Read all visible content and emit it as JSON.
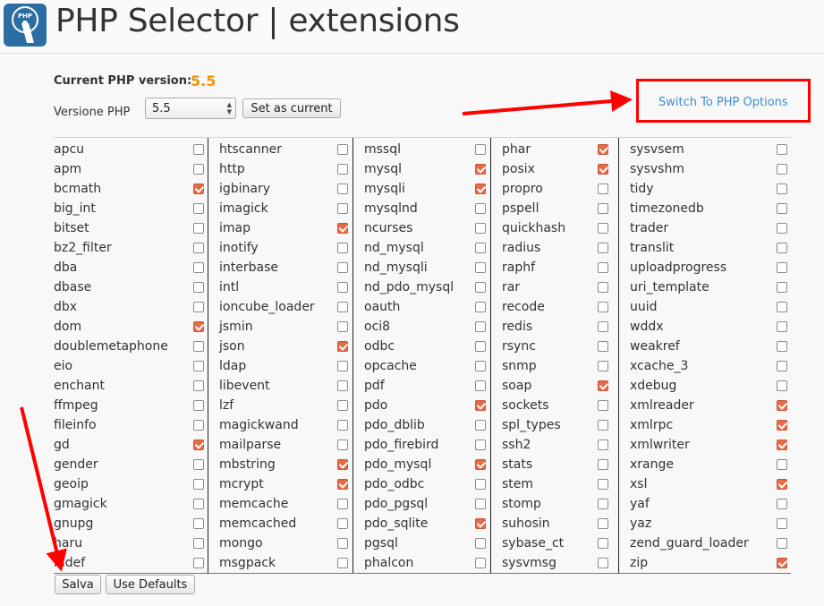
{
  "header": {
    "title": "PHP Selector | extensions",
    "logo_icon": "php-selector-logo-icon",
    "logo_text": "PHP"
  },
  "current": {
    "label": "Current PHP version:",
    "value": "5.5"
  },
  "version": {
    "label": "Versione PHP",
    "selected": "5.5",
    "set_button": "Set as current"
  },
  "switch_link": "Switch To PHP Options",
  "columns": [
    [
      {
        "name": "apcu",
        "on": false
      },
      {
        "name": "apm",
        "on": false
      },
      {
        "name": "bcmath",
        "on": true
      },
      {
        "name": "big_int",
        "on": false
      },
      {
        "name": "bitset",
        "on": false
      },
      {
        "name": "bz2_filter",
        "on": false
      },
      {
        "name": "dba",
        "on": false
      },
      {
        "name": "dbase",
        "on": false
      },
      {
        "name": "dbx",
        "on": false
      },
      {
        "name": "dom",
        "on": true
      },
      {
        "name": "doublemetaphone",
        "on": false
      },
      {
        "name": "eio",
        "on": false
      },
      {
        "name": "enchant",
        "on": false
      },
      {
        "name": "ffmpeg",
        "on": false
      },
      {
        "name": "fileinfo",
        "on": false
      },
      {
        "name": "gd",
        "on": true
      },
      {
        "name": "gender",
        "on": false
      },
      {
        "name": "geoip",
        "on": false
      },
      {
        "name": "gmagick",
        "on": false
      },
      {
        "name": "gnupg",
        "on": false
      },
      {
        "name": "haru",
        "on": false
      },
      {
        "name": "hidef",
        "on": false
      }
    ],
    [
      {
        "name": "htscanner",
        "on": false
      },
      {
        "name": "http",
        "on": false
      },
      {
        "name": "igbinary",
        "on": false
      },
      {
        "name": "imagick",
        "on": false
      },
      {
        "name": "imap",
        "on": true
      },
      {
        "name": "inotify",
        "on": false
      },
      {
        "name": "interbase",
        "on": false
      },
      {
        "name": "intl",
        "on": false
      },
      {
        "name": "ioncube_loader",
        "on": false
      },
      {
        "name": "jsmin",
        "on": false
      },
      {
        "name": "json",
        "on": true
      },
      {
        "name": "ldap",
        "on": false
      },
      {
        "name": "libevent",
        "on": false
      },
      {
        "name": "lzf",
        "on": false
      },
      {
        "name": "magickwand",
        "on": false
      },
      {
        "name": "mailparse",
        "on": false
      },
      {
        "name": "mbstring",
        "on": true
      },
      {
        "name": "mcrypt",
        "on": true
      },
      {
        "name": "memcache",
        "on": false
      },
      {
        "name": "memcached",
        "on": false
      },
      {
        "name": "mongo",
        "on": false
      },
      {
        "name": "msgpack",
        "on": false
      }
    ],
    [
      {
        "name": "mssql",
        "on": false
      },
      {
        "name": "mysql",
        "on": true
      },
      {
        "name": "mysqli",
        "on": true
      },
      {
        "name": "mysqlnd",
        "on": false
      },
      {
        "name": "ncurses",
        "on": false
      },
      {
        "name": "nd_mysql",
        "on": false
      },
      {
        "name": "nd_mysqli",
        "on": false
      },
      {
        "name": "nd_pdo_mysql",
        "on": false
      },
      {
        "name": "oauth",
        "on": false
      },
      {
        "name": "oci8",
        "on": false
      },
      {
        "name": "odbc",
        "on": false
      },
      {
        "name": "opcache",
        "on": false
      },
      {
        "name": "pdf",
        "on": false
      },
      {
        "name": "pdo",
        "on": true
      },
      {
        "name": "pdo_dblib",
        "on": false
      },
      {
        "name": "pdo_firebird",
        "on": false
      },
      {
        "name": "pdo_mysql",
        "on": true
      },
      {
        "name": "pdo_odbc",
        "on": false
      },
      {
        "name": "pdo_pgsql",
        "on": false
      },
      {
        "name": "pdo_sqlite",
        "on": true
      },
      {
        "name": "pgsql",
        "on": false
      },
      {
        "name": "phalcon",
        "on": false
      }
    ],
    [
      {
        "name": "phar",
        "on": true
      },
      {
        "name": "posix",
        "on": true
      },
      {
        "name": "propro",
        "on": false
      },
      {
        "name": "pspell",
        "on": false
      },
      {
        "name": "quickhash",
        "on": false
      },
      {
        "name": "radius",
        "on": false
      },
      {
        "name": "raphf",
        "on": false
      },
      {
        "name": "rar",
        "on": false
      },
      {
        "name": "recode",
        "on": false
      },
      {
        "name": "redis",
        "on": false
      },
      {
        "name": "rsync",
        "on": false
      },
      {
        "name": "snmp",
        "on": false
      },
      {
        "name": "soap",
        "on": true
      },
      {
        "name": "sockets",
        "on": false
      },
      {
        "name": "spl_types",
        "on": false
      },
      {
        "name": "ssh2",
        "on": false
      },
      {
        "name": "stats",
        "on": false
      },
      {
        "name": "stem",
        "on": false
      },
      {
        "name": "stomp",
        "on": false
      },
      {
        "name": "suhosin",
        "on": false
      },
      {
        "name": "sybase_ct",
        "on": false
      },
      {
        "name": "sysvmsg",
        "on": false
      }
    ],
    [
      {
        "name": "sysvsem",
        "on": false
      },
      {
        "name": "sysvshm",
        "on": false
      },
      {
        "name": "tidy",
        "on": false
      },
      {
        "name": "timezonedb",
        "on": false
      },
      {
        "name": "trader",
        "on": false
      },
      {
        "name": "translit",
        "on": false
      },
      {
        "name": "uploadprogress",
        "on": false
      },
      {
        "name": "uri_template",
        "on": false
      },
      {
        "name": "uuid",
        "on": false
      },
      {
        "name": "wddx",
        "on": false
      },
      {
        "name": "weakref",
        "on": false
      },
      {
        "name": "xcache_3",
        "on": false
      },
      {
        "name": "xdebug",
        "on": false
      },
      {
        "name": "xmlreader",
        "on": true
      },
      {
        "name": "xmlrpc",
        "on": true
      },
      {
        "name": "xmlwriter",
        "on": true
      },
      {
        "name": "xrange",
        "on": false
      },
      {
        "name": "xsl",
        "on": true
      },
      {
        "name": "yaf",
        "on": false
      },
      {
        "name": "yaz",
        "on": false
      },
      {
        "name": "zend_guard_loader",
        "on": false
      },
      {
        "name": "zip",
        "on": true
      }
    ]
  ],
  "footer": {
    "save": "Salva",
    "defaults": "Use Defaults"
  },
  "colors": {
    "accent_orange": "#f39200",
    "link_blue": "#3b8dd1",
    "annotation_red": "#ff0000",
    "checkbox_on": "#e96b46"
  }
}
